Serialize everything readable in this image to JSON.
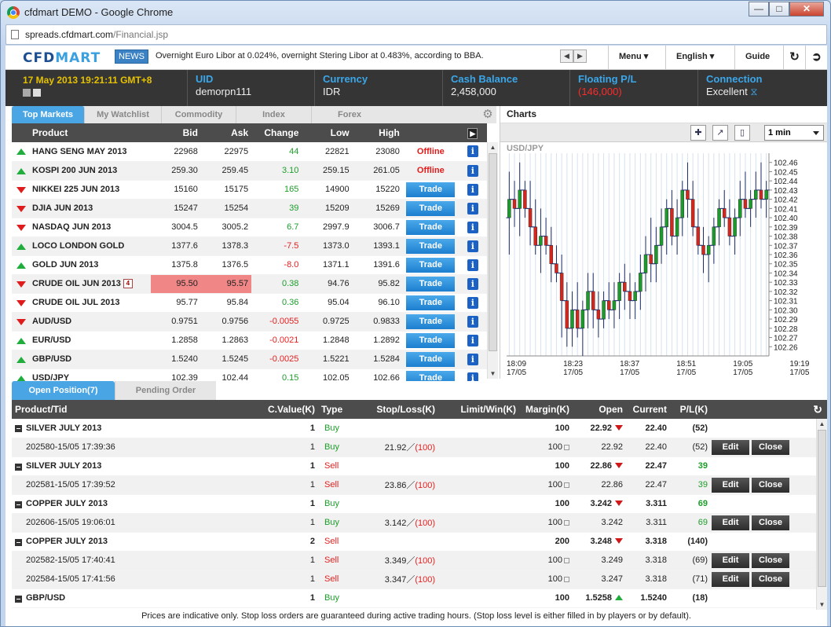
{
  "window": {
    "title": "cfdmart DEMO - Google Chrome",
    "url_host": "spreads.cfdmart.com",
    "url_path": "/Financial.jsp"
  },
  "header": {
    "logo_a": "CFD",
    "logo_b": "MART",
    "news_label": "NEWS",
    "news_text": "Overnight Euro Libor at 0.024%, overnight Stering Libor at 0.483%, according to BBA.",
    "menu": "Menu",
    "language": "English",
    "guide": "Guide"
  },
  "account": {
    "datetime": "17 May 2013 19:21:11 GMT+8",
    "uid_label": "UID",
    "uid": "demorpn111",
    "currency_label": "Currency",
    "currency": "IDR",
    "cash_label": "Cash Balance",
    "cash": "2,458,000",
    "pl_label": "Floating P/L",
    "pl": "(146,000)",
    "conn_label": "Connection",
    "conn": "Excellent"
  },
  "markets": {
    "tabs": [
      "Top Markets",
      "My Watchlist",
      "Commodity",
      "Index",
      "Forex"
    ],
    "columns": [
      "Product",
      "Bid",
      "Ask",
      "Change",
      "Low",
      "High"
    ],
    "trade_label": "Trade",
    "offline_label": "Offline",
    "rows": [
      {
        "name": "HANG SENG MAY 2013",
        "dir": "up",
        "bid": "22968",
        "ask": "22975",
        "change": "44",
        "low": "22821",
        "high": "23080",
        "status": "offline"
      },
      {
        "name": "KOSPI 200 JUN 2013",
        "dir": "up",
        "bid": "259.30",
        "ask": "259.45",
        "change": "3.10",
        "low": "259.15",
        "high": "261.05",
        "status": "offline"
      },
      {
        "name": "NIKKEI 225 JUN 2013",
        "dir": "down",
        "bid": "15160",
        "ask": "15175",
        "change": "165",
        "low": "14900",
        "high": "15220",
        "status": "trade"
      },
      {
        "name": "DJIA JUN 2013",
        "dir": "down",
        "bid": "15247",
        "ask": "15254",
        "change": "39",
        "low": "15209",
        "high": "15269",
        "status": "trade"
      },
      {
        "name": "NASDAQ JUN 2013",
        "dir": "down",
        "bid": "3004.5",
        "ask": "3005.2",
        "change": "6.7",
        "low": "2997.9",
        "high": "3006.7",
        "status": "trade"
      },
      {
        "name": "LOCO LONDON GOLD",
        "dir": "up",
        "bid": "1377.6",
        "ask": "1378.3",
        "change": "-7.5",
        "low": "1373.0",
        "high": "1393.1",
        "status": "trade"
      },
      {
        "name": "GOLD JUN 2013",
        "dir": "up",
        "bid": "1375.8",
        "ask": "1376.5",
        "change": "-8.0",
        "low": "1371.1",
        "high": "1391.6",
        "status": "trade"
      },
      {
        "name": "CRUDE OIL JUN 2013",
        "dir": "down",
        "bid": "95.50",
        "ask": "95.57",
        "change": "0.38",
        "low": "94.76",
        "high": "95.82",
        "status": "trade",
        "highlight": true,
        "cal": "4"
      },
      {
        "name": "CRUDE OIL JUL 2013",
        "dir": "down",
        "bid": "95.77",
        "ask": "95.84",
        "change": "0.36",
        "low": "95.04",
        "high": "96.10",
        "status": "trade"
      },
      {
        "name": "AUD/USD",
        "dir": "down",
        "bid": "0.9751",
        "ask": "0.9756",
        "change": "-0.0055",
        "low": "0.9725",
        "high": "0.9833",
        "status": "trade"
      },
      {
        "name": "EUR/USD",
        "dir": "up",
        "bid": "1.2858",
        "ask": "1.2863",
        "change": "-0.0021",
        "low": "1.2848",
        "high": "1.2892",
        "status": "trade"
      },
      {
        "name": "GBP/USD",
        "dir": "up",
        "bid": "1.5240",
        "ask": "1.5245",
        "change": "-0.0025",
        "low": "1.5221",
        "high": "1.5284",
        "status": "trade"
      },
      {
        "name": "USD/JPY",
        "dir": "up",
        "bid": "102.39",
        "ask": "102.44",
        "change": "0.15",
        "low": "102.05",
        "high": "102.66",
        "status": "trade"
      }
    ]
  },
  "chart_panel": {
    "title": "Charts",
    "interval": "1 min"
  },
  "chart_data": {
    "type": "candlestick",
    "symbol": "USD/JPY",
    "y_ticks": [
      "102.46",
      "102.45",
      "102.44",
      "102.43",
      "102.42",
      "102.41",
      "102.40",
      "102.39",
      "102.38",
      "102.37",
      "102.36",
      "102.35",
      "102.34",
      "102.33",
      "102.32",
      "102.31",
      "102.30",
      "102.29",
      "102.28",
      "102.27",
      "102.26"
    ],
    "ylim": [
      102.25,
      102.47
    ],
    "x_ticks": [
      {
        "time": "18:09",
        "date": "17/05"
      },
      {
        "time": "18:23",
        "date": "17/05"
      },
      {
        "time": "18:37",
        "date": "17/05"
      },
      {
        "time": "18:51",
        "date": "17/05"
      },
      {
        "time": "19:05",
        "date": "17/05"
      },
      {
        "time": "19:19",
        "date": "17/05"
      }
    ],
    "candles": [
      [
        102.4,
        102.45,
        102.36,
        102.42
      ],
      [
        102.42,
        102.44,
        102.39,
        102.41
      ],
      [
        102.41,
        102.46,
        102.38,
        102.43
      ],
      [
        102.43,
        102.44,
        102.4,
        102.41
      ],
      [
        102.41,
        102.44,
        102.37,
        102.39
      ],
      [
        102.39,
        102.42,
        102.36,
        102.37
      ],
      [
        102.37,
        102.41,
        102.34,
        102.38
      ],
      [
        102.38,
        102.4,
        102.36,
        102.37
      ],
      [
        102.37,
        102.39,
        102.33,
        102.35
      ],
      [
        102.35,
        102.37,
        102.33,
        102.34
      ],
      [
        102.34,
        102.36,
        102.27,
        102.31
      ],
      [
        102.31,
        102.33,
        102.26,
        102.28
      ],
      [
        102.28,
        102.32,
        102.26,
        102.3
      ],
      [
        102.3,
        102.33,
        102.27,
        102.28
      ],
      [
        102.28,
        102.31,
        102.25,
        102.3
      ],
      [
        102.3,
        102.34,
        102.28,
        102.32
      ],
      [
        102.32,
        102.34,
        102.28,
        102.3
      ],
      [
        102.3,
        102.32,
        102.27,
        102.29
      ],
      [
        102.29,
        102.32,
        102.28,
        102.31
      ],
      [
        102.31,
        102.33,
        102.29,
        102.3
      ],
      [
        102.3,
        102.33,
        102.28,
        102.31
      ],
      [
        102.31,
        102.34,
        102.29,
        102.33
      ],
      [
        102.33,
        102.35,
        102.3,
        102.32
      ],
      [
        102.32,
        102.34,
        102.29,
        102.31
      ],
      [
        102.31,
        102.33,
        102.29,
        102.32
      ],
      [
        102.32,
        102.36,
        102.3,
        102.34
      ],
      [
        102.34,
        102.38,
        102.32,
        102.36
      ],
      [
        102.36,
        102.4,
        102.33,
        102.35
      ],
      [
        102.35,
        102.39,
        102.33,
        102.37
      ],
      [
        102.37,
        102.41,
        102.35,
        102.39
      ],
      [
        102.39,
        102.42,
        102.36,
        102.41
      ],
      [
        102.41,
        102.43,
        102.37,
        102.38
      ],
      [
        102.38,
        102.42,
        102.36,
        102.4
      ],
      [
        102.4,
        102.44,
        102.38,
        102.43
      ],
      [
        102.43,
        102.46,
        102.4,
        102.42
      ],
      [
        102.42,
        102.44,
        102.38,
        102.39
      ],
      [
        102.39,
        102.41,
        102.36,
        102.37
      ],
      [
        102.37,
        102.39,
        102.34,
        102.36
      ],
      [
        102.36,
        102.38,
        102.33,
        102.37
      ],
      [
        102.37,
        102.4,
        102.35,
        102.39
      ],
      [
        102.39,
        102.42,
        102.37,
        102.41
      ],
      [
        102.41,
        102.43,
        102.39,
        102.4
      ],
      [
        102.4,
        102.42,
        102.37,
        102.38
      ],
      [
        102.38,
        102.41,
        102.36,
        102.4
      ],
      [
        102.4,
        102.44,
        102.38,
        102.42
      ],
      [
        102.42,
        102.45,
        102.4,
        102.41
      ],
      [
        102.41,
        102.43,
        102.39,
        102.42
      ],
      [
        102.42,
        102.45,
        102.4,
        102.43
      ],
      [
        102.43,
        102.46,
        102.41,
        102.42
      ],
      [
        102.42,
        102.44,
        102.4,
        102.43
      ]
    ]
  },
  "positions": {
    "tabs": [
      "Open Position(7)",
      "Pending Order"
    ],
    "columns": [
      "Product/Tid",
      "C.Value(K)",
      "Type",
      "Stop/Loss(K)",
      "Limit/Win(K)",
      "Margin(K)",
      "Open",
      "Current",
      "P/L(K)"
    ],
    "edit_label": "Edit",
    "close_label": "Close",
    "rows": [
      {
        "kind": "group",
        "name": "SILVER JULY 2013",
        "cvalue": "1",
        "type": "Buy",
        "stop": "",
        "margin": "100",
        "open": "22.92",
        "open_dir": "down",
        "current": "22.40",
        "pl": "(52)",
        "pl_neg": true
      },
      {
        "kind": "sub",
        "name": "202580-15/05 17:39:36",
        "cvalue": "1",
        "type": "Buy",
        "stop": "21.92",
        "stop_loss": "(100)",
        "margin": "100",
        "open": "22.92",
        "current": "22.40",
        "pl": "(52)",
        "pl_neg": true
      },
      {
        "kind": "group",
        "name": "SILVER JULY 2013",
        "cvalue": "1",
        "type": "Sell",
        "stop": "",
        "margin": "100",
        "open": "22.86",
        "open_dir": "down",
        "current": "22.47",
        "pl": "39",
        "pl_neg": false
      },
      {
        "kind": "sub",
        "name": "202581-15/05 17:39:52",
        "cvalue": "1",
        "type": "Sell",
        "stop": "23.86",
        "stop_loss": "(100)",
        "margin": "100",
        "open": "22.86",
        "current": "22.47",
        "pl": "39",
        "pl_neg": false
      },
      {
        "kind": "group",
        "name": "COPPER JULY 2013",
        "cvalue": "1",
        "type": "Buy",
        "stop": "",
        "margin": "100",
        "open": "3.242",
        "open_dir": "down",
        "current": "3.311",
        "pl": "69",
        "pl_neg": false
      },
      {
        "kind": "sub",
        "name": "202606-15/05 19:06:01",
        "cvalue": "1",
        "type": "Buy",
        "stop": "3.142",
        "stop_loss": "(100)",
        "margin": "100",
        "open": "3.242",
        "current": "3.311",
        "pl": "69",
        "pl_neg": false
      },
      {
        "kind": "group",
        "name": "COPPER JULY 2013",
        "cvalue": "2",
        "type": "Sell",
        "stop": "",
        "margin": "200",
        "open": "3.248",
        "open_dir": "down",
        "current": "3.318",
        "pl": "(140)",
        "pl_neg": true
      },
      {
        "kind": "sub",
        "name": "202582-15/05 17:40:41",
        "cvalue": "1",
        "type": "Sell",
        "stop": "3.349",
        "stop_loss": "(100)",
        "margin": "100",
        "open": "3.249",
        "current": "3.318",
        "pl": "(69)",
        "pl_neg": true
      },
      {
        "kind": "sub",
        "name": "202584-15/05 17:41:56",
        "cvalue": "1",
        "type": "Sell",
        "stop": "3.347",
        "stop_loss": "(100)",
        "margin": "100",
        "open": "3.247",
        "current": "3.318",
        "pl": "(71)",
        "pl_neg": true
      },
      {
        "kind": "group",
        "name": "GBP/USD",
        "cvalue": "1",
        "type": "Buy",
        "stop": "",
        "margin": "100",
        "open": "1.5258",
        "open_dir": "up",
        "current": "1.5240",
        "pl": "(18)",
        "pl_neg": true
      }
    ]
  },
  "footer": "Prices are indicative only. Stop loss orders are guaranteed during active trading hours. (Stop loss level is either filled in by players or by default).",
  "colors": {
    "accent": "#4aa5e5",
    "header_dark": "#353535",
    "up": "#1fae3b",
    "down": "#e01b1b"
  }
}
